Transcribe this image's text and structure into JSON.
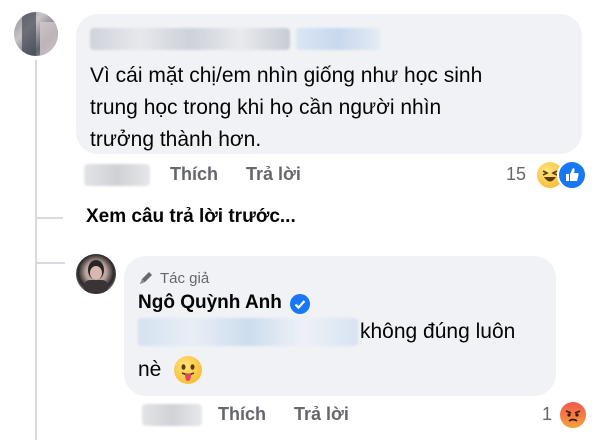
{
  "comment1": {
    "text_lines": [
      "Vì cái mặt chị/em nhìn giống như học sinh",
      "trung học trong khi họ cần người nhìn",
      "trưởng thành hơn."
    ],
    "like_label": "Thích",
    "reply_label": "Trả lời",
    "reaction_count": "15",
    "reaction_icons": [
      "haha-icon",
      "like-icon"
    ]
  },
  "view_previous": "Xem câu trả lời trước...",
  "reply": {
    "badge_label": "Tác giả",
    "author": "Ngô Quỳnh Anh",
    "verified": true,
    "text_line1": "không đúng luôn",
    "text_line2": "nè",
    "like_label": "Thích",
    "reply_label": "Trả lời",
    "reaction_count": "1",
    "reaction_icons": [
      "angry-icon"
    ],
    "sticker_icon": "tongue-out-emoji-icon"
  },
  "colors": {
    "bubble": "#f0f2f5",
    "meta_text": "#65676b",
    "verified": "#1877f2",
    "like_blue": "#1877f2",
    "angry_orange": "#f0584f"
  }
}
